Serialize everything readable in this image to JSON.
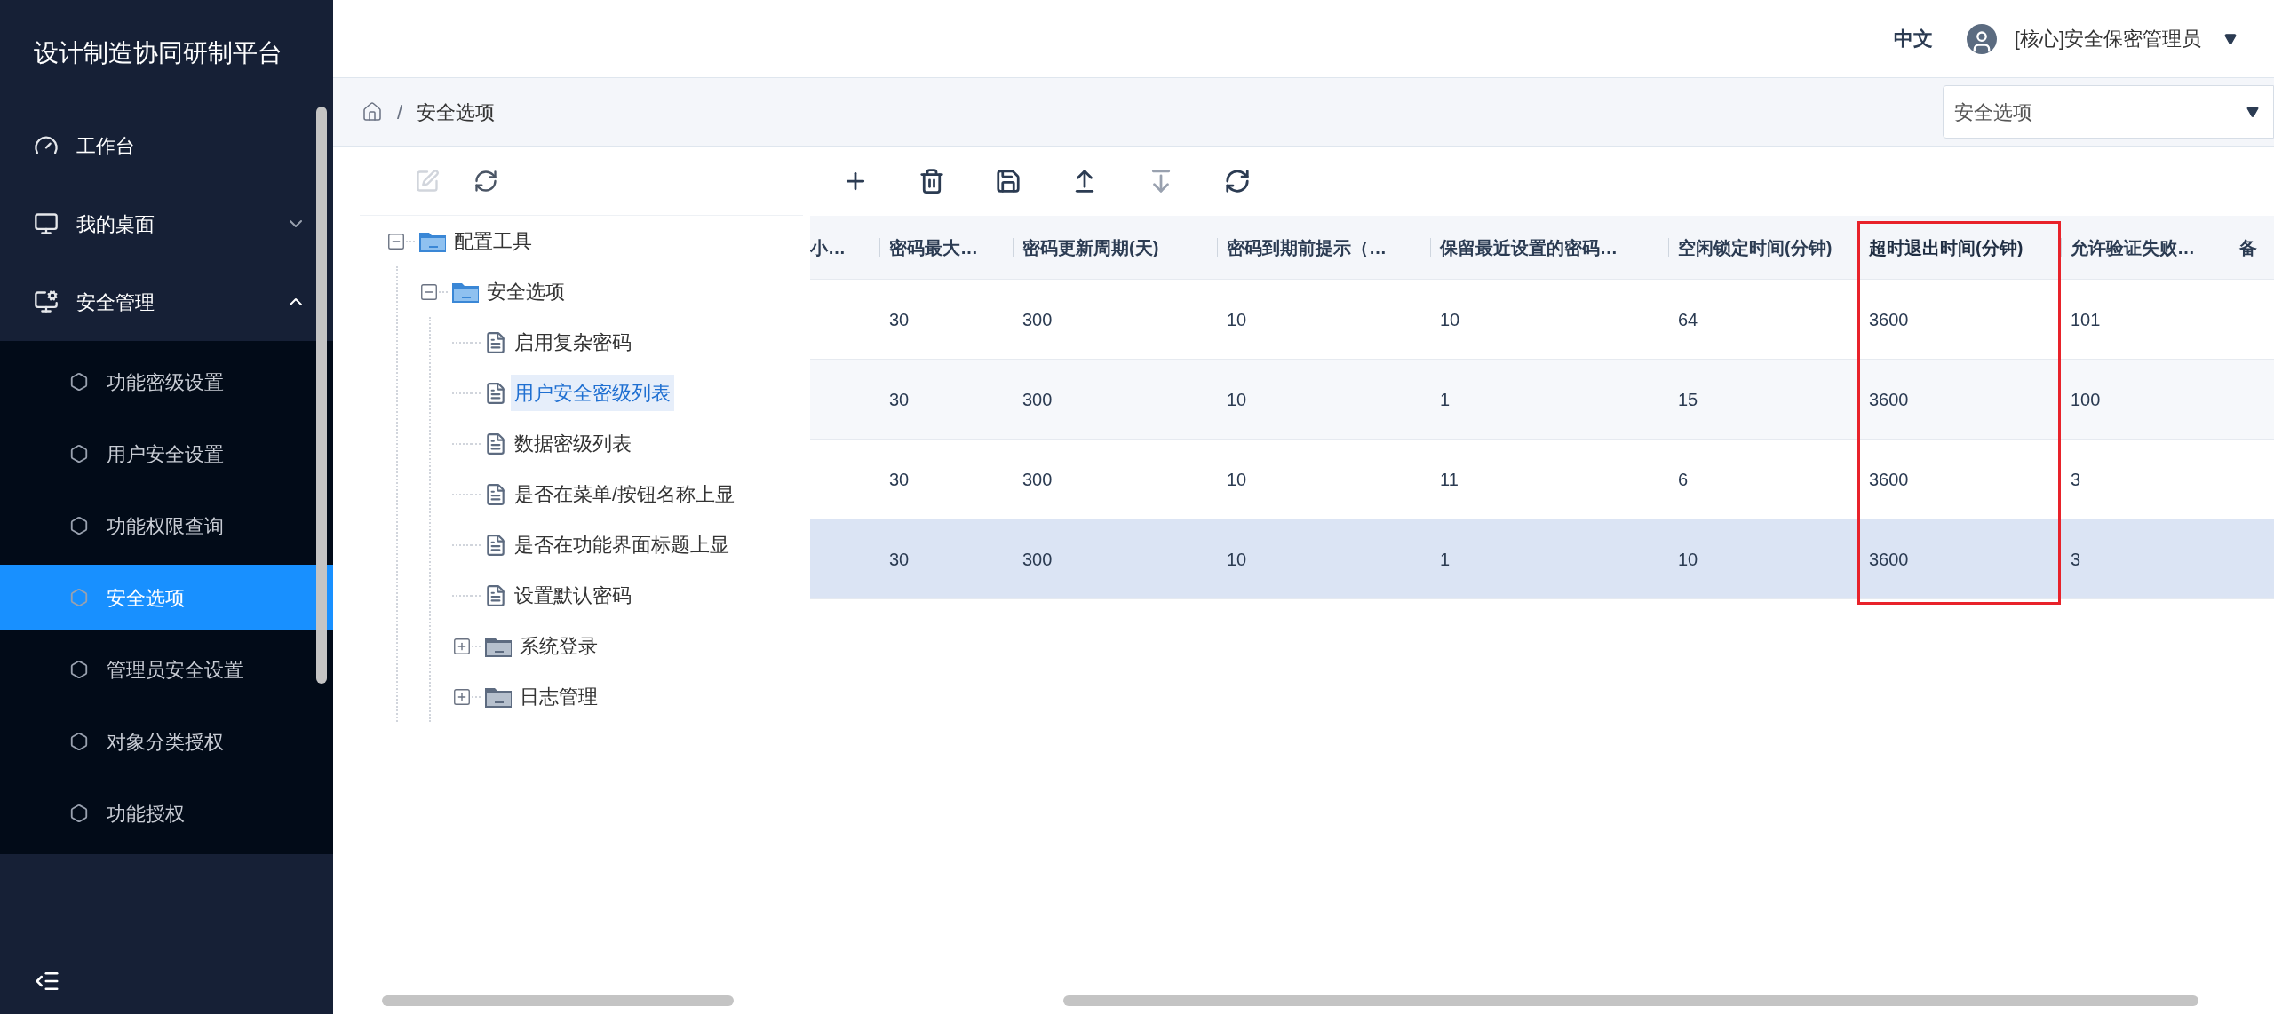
{
  "app_title": "设计制造协同研制平台",
  "sidebar": {
    "items": [
      {
        "label": "工作台",
        "kind": "link"
      },
      {
        "label": "我的桌面",
        "kind": "group",
        "expanded": false
      },
      {
        "label": "安全管理",
        "kind": "group",
        "expanded": true,
        "children": [
          {
            "label": "功能密级设置",
            "selected": false
          },
          {
            "label": "用户安全设置",
            "selected": false
          },
          {
            "label": "功能权限查询",
            "selected": false
          },
          {
            "label": "安全选项",
            "selected": true
          },
          {
            "label": "管理员安全设置",
            "selected": false
          },
          {
            "label": "对象分类授权",
            "selected": false
          },
          {
            "label": "功能授权",
            "selected": false
          }
        ]
      }
    ]
  },
  "header": {
    "language": "中文",
    "user": "[核心]安全保密管理员"
  },
  "breadcrumb": {
    "separator": "/",
    "items": [
      "安全选项"
    ]
  },
  "page_select": {
    "value": "安全选项"
  },
  "tree_toolbar": [
    {
      "disabled": true
    },
    {
      "disabled": false
    }
  ],
  "tree": [
    {
      "label": "配置工具",
      "kind": "folder",
      "expanded": true,
      "selected": false,
      "children": [
        {
          "label": "安全选项",
          "kind": "folder",
          "expanded": true,
          "selected": false,
          "children": [
            {
              "label": "启用复杂密码",
              "kind": "leaf",
              "selected": false
            },
            {
              "label": "用户安全密级列表",
              "kind": "leaf",
              "selected": true
            },
            {
              "label": "数据密级列表",
              "kind": "leaf",
              "selected": false
            },
            {
              "label": "是否在菜单/按钮名称上显",
              "kind": "leaf",
              "selected": false
            },
            {
              "label": "是否在功能界面标题上显",
              "kind": "leaf",
              "selected": false
            },
            {
              "label": "设置默认密码",
              "kind": "leaf",
              "selected": false
            },
            {
              "label": "系统登录",
              "kind": "folder",
              "expanded": false,
              "selected": false
            },
            {
              "label": "日志管理",
              "kind": "folder",
              "expanded": false,
              "selected": false
            }
          ]
        }
      ]
    }
  ],
  "table_toolbar": [
    {
      "disabled": false
    },
    {
      "disabled": false
    },
    {
      "disabled": false
    },
    {
      "disabled": false
    },
    {
      "disabled": true
    },
    {
      "disabled": false
    }
  ],
  "table": {
    "columns": [
      {
        "label": "小…",
        "highlighted": false
      },
      {
        "label": "密码最大…",
        "highlighted": false
      },
      {
        "label": "密码更新周期(天)",
        "highlighted": false
      },
      {
        "label": "密码到期前提示（…",
        "highlighted": false
      },
      {
        "label": "保留最近设置的密码…",
        "highlighted": false
      },
      {
        "label": "空闲锁定时间(分钟)",
        "highlighted": false
      },
      {
        "label": "超时退出时间(分钟)",
        "highlighted": true
      },
      {
        "label": "允许验证失败…",
        "highlighted": false
      },
      {
        "label": "备",
        "highlighted": false
      }
    ],
    "rows": [
      {
        "cells": [
          "",
          "30",
          "300",
          "10",
          "10",
          "64",
          "3600",
          "101"
        ],
        "selected": false
      },
      {
        "cells": [
          "",
          "30",
          "300",
          "10",
          "1",
          "15",
          "3600",
          "100"
        ],
        "selected": false
      },
      {
        "cells": [
          "",
          "30",
          "300",
          "10",
          "11",
          "6",
          "3600",
          "3"
        ],
        "selected": false
      },
      {
        "cells": [
          "",
          "30",
          "300",
          "10",
          "1",
          "10",
          "3600",
          "3"
        ],
        "selected": true
      }
    ]
  }
}
